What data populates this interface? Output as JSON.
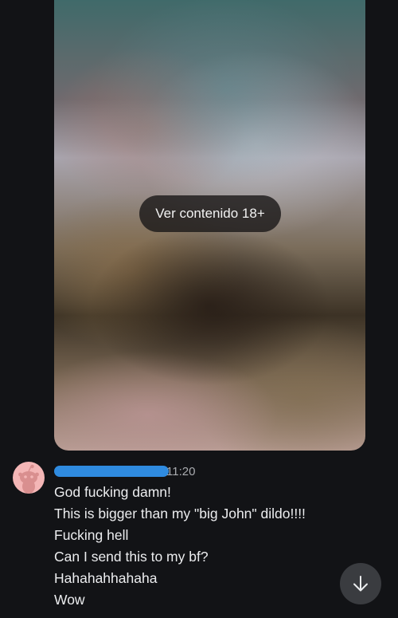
{
  "media": {
    "nsfw_button_label": "Ver contenido 18+"
  },
  "message": {
    "timestamp": "11:20",
    "lines": [
      "God fucking damn!",
      "This is bigger than my \"big John\" dildo!!!!",
      "Fucking hell",
      "Can I send this to my bf?",
      "Hahahahhahaha",
      "Wow"
    ]
  },
  "icons": {
    "avatar": "reddit-snoo-icon",
    "scroll": "arrow-down-icon"
  },
  "colors": {
    "background": "#121316",
    "avatar_bg": "#f4b6b6",
    "redaction": "#2f8be0",
    "scroll_button": "#3a3c40"
  }
}
